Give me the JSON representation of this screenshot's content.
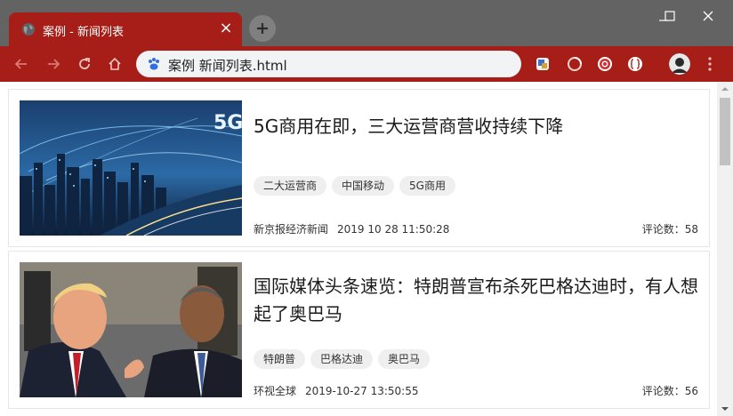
{
  "browser": {
    "tab_title": "案例 - 新闻列表",
    "tab_close": "×",
    "address": "案例 新闻列表.html",
    "colors": {
      "accent": "#a61e17",
      "tabstrip": "#636363",
      "omnibox": "#f1f3f4"
    }
  },
  "news": [
    {
      "title": "5G商用在即，三大运营商营收持续下降",
      "image_alt": "5G city night skyline",
      "image_text": "5G",
      "tags": [
        "二大运营商",
        "中国移动",
        "5G商用"
      ],
      "source": "新京报经济新闻",
      "time": "2019 10 28 11:50:28",
      "comments": "评论数：58"
    },
    {
      "title": "国际媒体头条速览：特朗普宣布杀死巴格达迪时，有人想起了奥巴马",
      "image_alt": "Trump and Obama",
      "tags": [
        "特朗普",
        "巴格达迪",
        "奥巴马"
      ],
      "source": "环视全球",
      "time": "2019-10-27 13:50:55",
      "comments": "评论数：56"
    }
  ]
}
